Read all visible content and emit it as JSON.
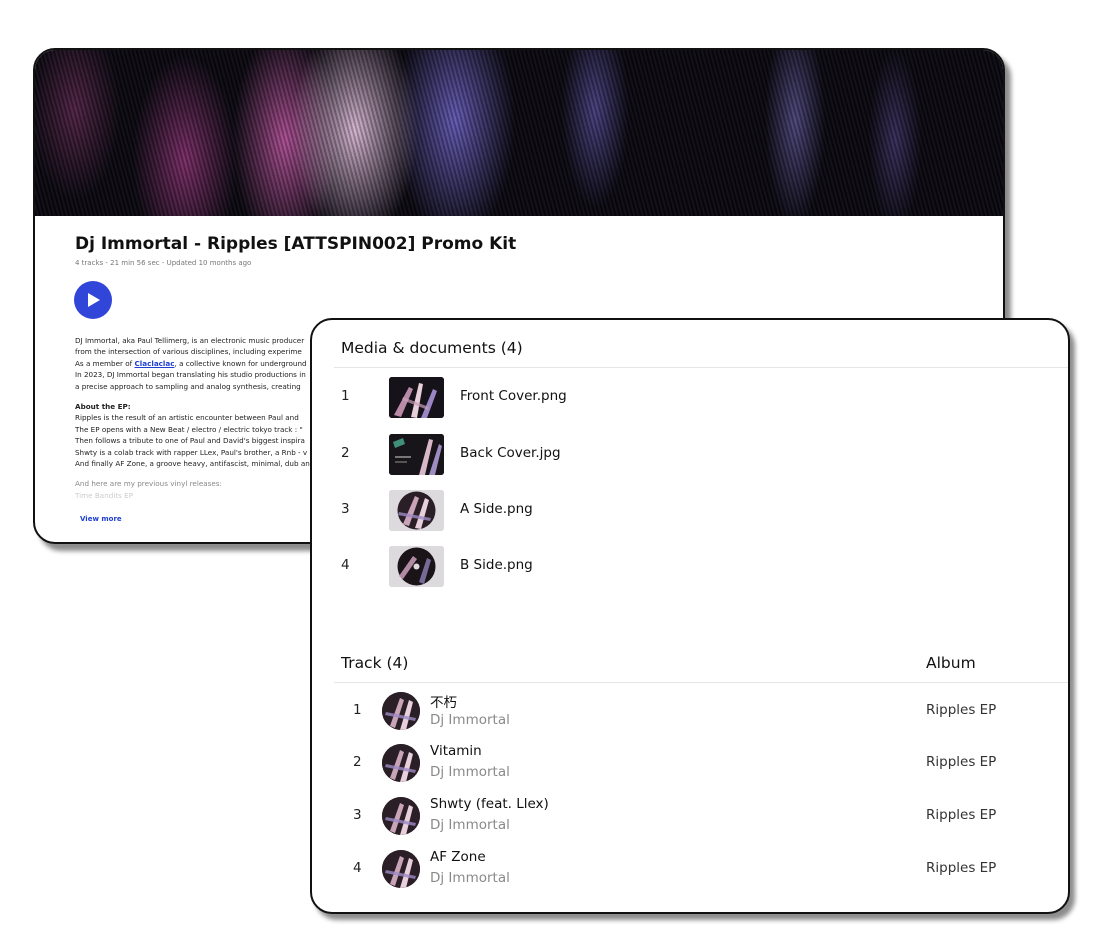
{
  "promo_kit": {
    "title": "Dj Immortal - Ripples [ATTSPIN002] Promo Kit",
    "meta": "4 tracks - 21 min 56 sec - Updated 10 months ago",
    "play_icon": "play-icon",
    "bio": {
      "line1": "DJ Immortal, aka Paul Tellimerg, is an electronic music producer",
      "line2": "from the intersection of various disciplines, including experime",
      "line3_prefix": "As a member of ",
      "line3_link": "Claclaclac",
      "line3_suffix": ", a collective known for underground",
      "line4": "In 2023, DJ Immortal began translating his studio productions in",
      "line5": "a precise approach to sampling and analog synthesis, creating",
      "about_heading": "About the EP:",
      "about1": "Ripples is the result of an artistic encounter between Paul and",
      "about2": "The EP opens with a New Beat / electro / electric tokyo track : \"",
      "about3": "Then follows a tribute to one of Paul and David's biggest inspira",
      "about4": "Shwty is a colab track with rapper LLex, Paul's brother, a Rnb - v",
      "about5": "And finally AF Zone, a groove heavy, antifascist, minimal, dub an",
      "previous": "And here are my previous vinyl releases:",
      "previous_item": "Time Bandits EP"
    },
    "view_more": "View more"
  },
  "media": {
    "heading": "Media & documents (4)",
    "items": [
      {
        "num": "1",
        "name": "Front Cover.png"
      },
      {
        "num": "2",
        "name": "Back Cover.jpg"
      },
      {
        "num": "3",
        "name": "A Side.png"
      },
      {
        "num": "4",
        "name": "B Side.png"
      }
    ]
  },
  "tracks": {
    "heading": "Track (4)",
    "album_heading": "Album",
    "items": [
      {
        "num": "1",
        "title": "不朽",
        "artist": "Dj Immortal",
        "album": "Ripples EP"
      },
      {
        "num": "2",
        "title": "Vitamin",
        "artist": "Dj Immortal",
        "album": "Ripples EP"
      },
      {
        "num": "3",
        "title": "Shwty (feat. Llex)",
        "artist": "Dj Immortal",
        "album": "Ripples EP"
      },
      {
        "num": "4",
        "title": "AF Zone",
        "artist": "Dj Immortal",
        "album": "Ripples EP"
      }
    ]
  },
  "colors": {
    "accent": "#3146d8",
    "link": "#1e3fcf",
    "muted_text": "#8a8a8a"
  }
}
